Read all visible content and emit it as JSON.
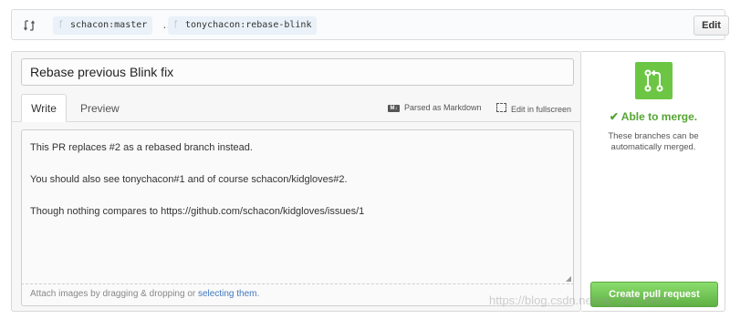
{
  "compare": {
    "base_branch": "schacon:master",
    "separator": "…",
    "head_branch": "tonychacon:rebase-blink",
    "edit_label": "Edit"
  },
  "form": {
    "title_value": "Rebase previous Blink fix",
    "tabs": [
      {
        "label": "Write"
      },
      {
        "label": "Preview"
      }
    ],
    "toolbar": {
      "markdown_label": "Parsed as Markdown",
      "fullscreen_label": "Edit in fullscreen"
    },
    "body_lines": [
      "This PR replaces #2 as a rebased branch instead.",
      "You should also see tonychacon#1 and of course schacon/kidgloves#2.",
      "Though nothing compares to https://github.com/schacon/kidgloves/issues/1"
    ],
    "attach_prefix": "Attach images by dragging & dropping or ",
    "attach_link": "selecting them",
    "attach_suffix": "."
  },
  "merge": {
    "status": "✔ Able to merge.",
    "description": "These branches can be automatically merged.",
    "icon": "pull-request-icon",
    "accent": "#6cc644",
    "create_label": "Create pull request"
  },
  "watermark": "https://blog.csdn.net/qq_30216635"
}
